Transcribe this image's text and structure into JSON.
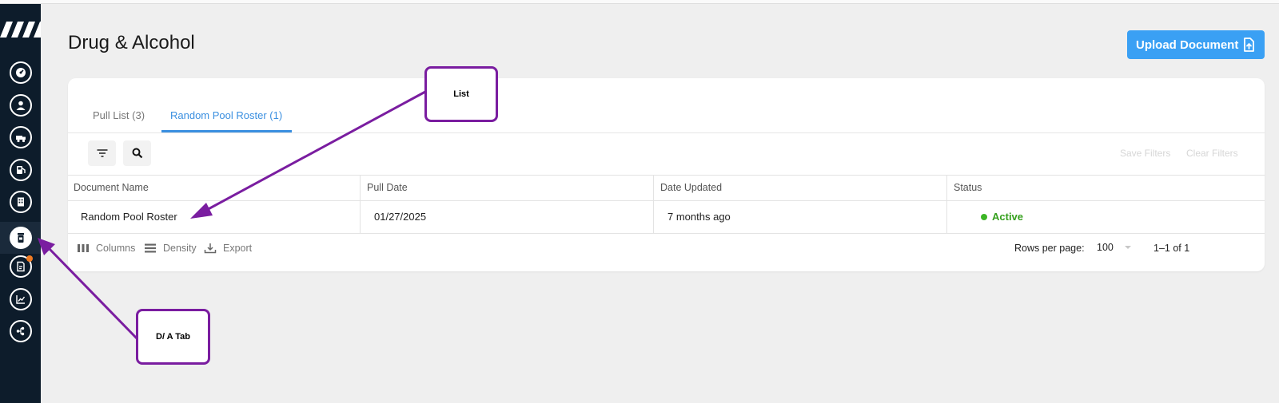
{
  "page": {
    "title": "Drug & Alcohol"
  },
  "header": {
    "upload_label": "Upload Document"
  },
  "sidebar": {
    "items": [
      {
        "icon": "dashboard-icon"
      },
      {
        "icon": "user-icon"
      },
      {
        "icon": "truck-icon"
      },
      {
        "icon": "fuel-icon"
      },
      {
        "icon": "building-icon"
      },
      {
        "icon": "drug-alcohol-icon",
        "active": true
      },
      {
        "icon": "document-icon",
        "notification": true
      },
      {
        "icon": "chart-icon"
      },
      {
        "icon": "integration-icon"
      }
    ]
  },
  "tabs": [
    {
      "label": "Pull List (3)",
      "active": false
    },
    {
      "label": "Random Pool Roster (1)",
      "active": true
    }
  ],
  "toolbar": {
    "save_filters": "Save Filters",
    "clear_filters": "Clear Filters"
  },
  "table": {
    "columns": [
      "Document Name",
      "Pull Date",
      "Date Updated",
      "Status"
    ],
    "rows": [
      {
        "document_name": "Random Pool Roster",
        "pull_date": "01/27/2025",
        "date_updated": "7 months ago",
        "status": "Active"
      }
    ]
  },
  "footer": {
    "columns_label": "Columns",
    "density_label": "Density",
    "export_label": "Export",
    "rows_per_page_label": "Rows per page:",
    "rows_per_page_value": "100",
    "pagination_text": "1–1 of 1"
  },
  "annotations": {
    "list_label": "List",
    "tab_label": "D/ A Tab"
  },
  "colors": {
    "accent": "#3aa0f4",
    "sidebar": "#0d1c2b",
    "active_status": "#35a01d",
    "callout_border": "#7a1da0"
  }
}
